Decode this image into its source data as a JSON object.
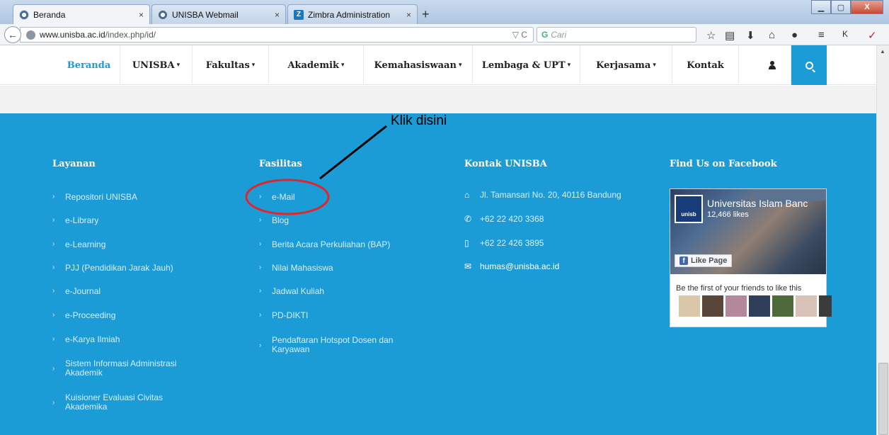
{
  "browser": {
    "tabs": [
      {
        "title": "Beranda",
        "close": "×"
      },
      {
        "title": "UNISBA Webmail",
        "close": "×"
      },
      {
        "title": "Zimbra Administration",
        "close": "×"
      }
    ],
    "new_tab": "+",
    "zimbra_badge": "Z",
    "url": "www.unisba.ac.id/index.php/id/",
    "url_host": "www.unisba.ac.id",
    "url_path": "/index.php/id/",
    "url_controls": "▽ C",
    "search_placeholder": "Cari",
    "window_buttons": [
      "▁",
      "▢",
      "X"
    ]
  },
  "site_nav": {
    "items": [
      {
        "label": "Beranda",
        "caret": ""
      },
      {
        "label": "UNISBA",
        "caret": "▾"
      },
      {
        "label": "Fakultas",
        "caret": "▾"
      },
      {
        "label": "Akademik",
        "caret": "▾"
      },
      {
        "label": "Kemahasiswaan",
        "caret": "▾"
      },
      {
        "label": "Lembaga & UPT",
        "caret": "▾"
      },
      {
        "label": "Kerjasama",
        "caret": "▾"
      },
      {
        "label": "Kontak",
        "caret": ""
      }
    ]
  },
  "annotation": {
    "text": "Klik disini"
  },
  "footer": {
    "layanan": {
      "title": "Layanan",
      "items": [
        "Repositori UNISBA",
        "e-Library",
        "e-Learning",
        "PJJ (Pendidikan Jarak Jauh)",
        "e-Journal",
        "e-Proceeding",
        "e-Karya Ilmiah",
        "Sistem Informasi Administrasi Akademik",
        "Kuisioner Evaluasi Civitas Akademika"
      ]
    },
    "fasilitas": {
      "title": "Fasilitas",
      "items": [
        "e-Mail",
        "Blog",
        "Berita Acara Perkuliahan (BAP)",
        "Nilai Mahasiswa",
        "Jadwal Kuliah",
        "PD-DIKTI",
        "Pendaftaran Hotspot Dosen dan Karyawan"
      ]
    },
    "kontak": {
      "title": "Kontak UNISBA",
      "address": "Jl. Tamansari No. 20, 40116 Bandung",
      "phone": "+62 22 420 3368",
      "mobile": "+62 22 426 3895",
      "email": "humas@unisba.ac.id"
    },
    "facebook": {
      "title": "Find Us on Facebook",
      "page_name": "Universitas Islam Banc",
      "likes": "12,466 likes",
      "like_button": "Like Page",
      "friends_text": "Be the first of your friends to like this",
      "logo_text": "unisb"
    }
  },
  "colors": {
    "brand_blue": "#1b9cd6",
    "annotation_red": "#e0262b"
  },
  "icons": {
    "address": "home-icon",
    "phone": "phone-icon",
    "mobile": "mobile-icon",
    "email": "envelope-icon"
  }
}
